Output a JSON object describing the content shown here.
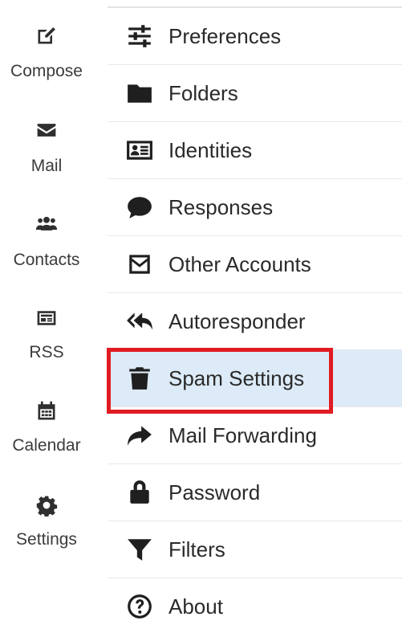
{
  "nav": {
    "items": [
      {
        "label": "Compose",
        "icon": "compose-icon"
      },
      {
        "label": "Mail",
        "icon": "envelope-icon"
      },
      {
        "label": "Contacts",
        "icon": "contacts-icon"
      },
      {
        "label": "RSS",
        "icon": "rss-icon"
      },
      {
        "label": "Calendar",
        "icon": "calendar-icon"
      },
      {
        "label": "Settings",
        "icon": "gear-icon"
      }
    ]
  },
  "settings_list": {
    "items": [
      {
        "label": "Preferences",
        "icon": "sliders-icon"
      },
      {
        "label": "Folders",
        "icon": "folder-icon"
      },
      {
        "label": "Identities",
        "icon": "id-card-icon"
      },
      {
        "label": "Responses",
        "icon": "speech-bubble-icon"
      },
      {
        "label": "Other Accounts",
        "icon": "envelope-square-icon"
      },
      {
        "label": "Autoresponder",
        "icon": "reply-all-icon"
      },
      {
        "label": "Spam Settings",
        "icon": "trash-icon",
        "selected": true
      },
      {
        "label": "Mail Forwarding",
        "icon": "share-arrow-icon"
      },
      {
        "label": "Password",
        "icon": "lock-icon"
      },
      {
        "label": "Filters",
        "icon": "funnel-icon"
      },
      {
        "label": "About",
        "icon": "question-circle-icon"
      }
    ]
  },
  "colors": {
    "selected_row_bg": "#dcebf7",
    "highlight_border": "#e11b22"
  }
}
